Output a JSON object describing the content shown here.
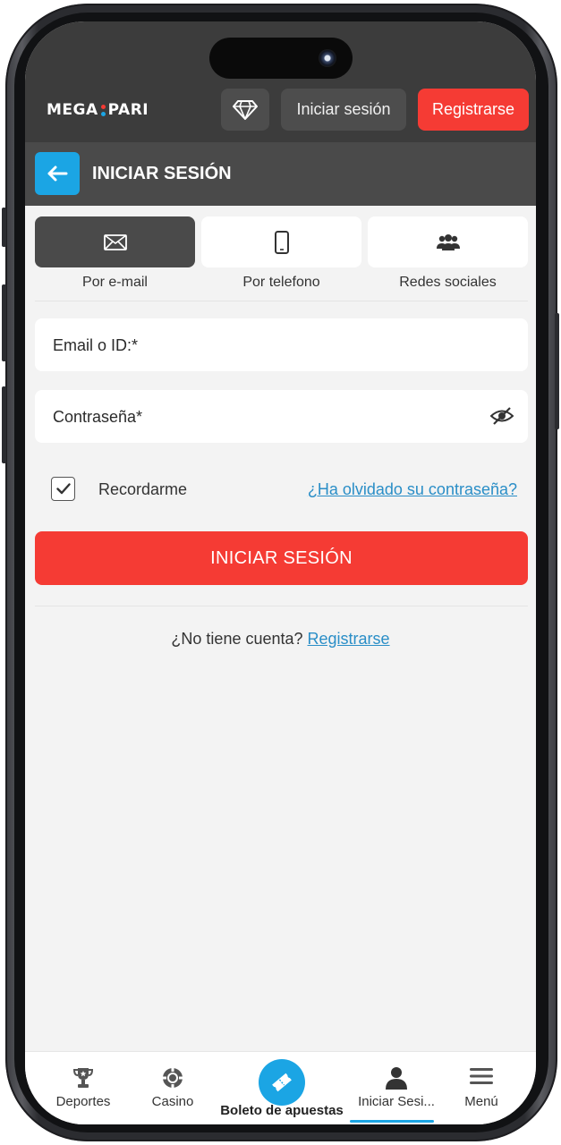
{
  "header": {
    "logo_left": "MEGA",
    "logo_right": "PARI",
    "login_label": "Iniciar sesión",
    "register_label": "Registrarse",
    "brand_colors": {
      "dot_top": "#f53b34",
      "dot_bottom": "#1ba5e4"
    }
  },
  "section": {
    "title": "INICIAR SESIÓN"
  },
  "tabs": [
    {
      "label": "Por e-mail",
      "icon": "envelope-icon",
      "active": true
    },
    {
      "label": "Por telefono",
      "icon": "phone-icon",
      "active": false
    },
    {
      "label": "Redes sociales",
      "icon": "users-icon",
      "active": false
    }
  ],
  "form": {
    "email_placeholder": "Email o ID:*",
    "password_placeholder": "Contraseña*",
    "remember_label": "Recordarme",
    "remember_checked": true,
    "forgot_label": "¿Ha olvidado su contraseña?",
    "submit_label": "INICIAR SESIÓN",
    "no_account_text": "¿No tiene cuenta?",
    "register_link": "Registrarse"
  },
  "bottom_nav": {
    "items": [
      {
        "label": "Deportes",
        "icon": "trophy-icon"
      },
      {
        "label": "Casino",
        "icon": "casino-chip-icon"
      },
      {
        "label": "Boleto de apuestas",
        "icon": "ticket-icon"
      },
      {
        "label": "Iniciar Sesi...",
        "icon": "user-icon"
      },
      {
        "label": "Menú",
        "icon": "hamburger-menu-icon"
      }
    ]
  },
  "colors": {
    "accent_red": "#f53b34",
    "accent_blue": "#1ba5e4",
    "header_dark": "#3c3c3c",
    "link_blue": "#2a8ec7"
  }
}
